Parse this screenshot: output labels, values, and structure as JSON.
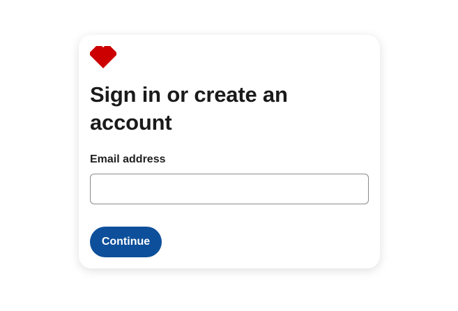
{
  "brand": {
    "logo_icon": "heart-icon",
    "logo_color": "#cc0000"
  },
  "form": {
    "title": "Sign in or create an account",
    "email_label": "Email address",
    "email_value": "",
    "email_placeholder": "",
    "continue_label": "Continue"
  },
  "colors": {
    "primary_button": "#0d4f9a",
    "text": "#1a1a1a"
  }
}
